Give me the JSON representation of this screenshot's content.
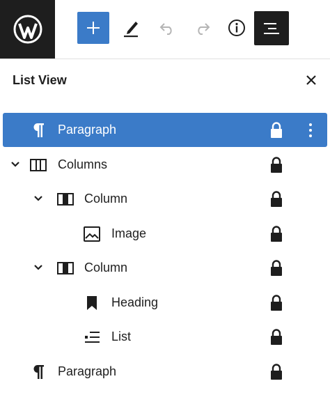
{
  "panel": {
    "title": "List View"
  },
  "blocks": [
    {
      "label": "Paragraph",
      "icon": "paragraph-icon"
    },
    {
      "label": "Columns",
      "icon": "columns-icon"
    },
    {
      "label": "Column",
      "icon": "column-icon"
    },
    {
      "label": "Image",
      "icon": "image-icon"
    },
    {
      "label": "Column",
      "icon": "column-icon"
    },
    {
      "label": "Heading",
      "icon": "heading-bookmark-icon"
    },
    {
      "label": "List",
      "icon": "list-icon"
    },
    {
      "label": "Paragraph",
      "icon": "paragraph-icon"
    }
  ],
  "colors": {
    "accent": "#3b7bc8",
    "dark": "#1e1e1e"
  }
}
